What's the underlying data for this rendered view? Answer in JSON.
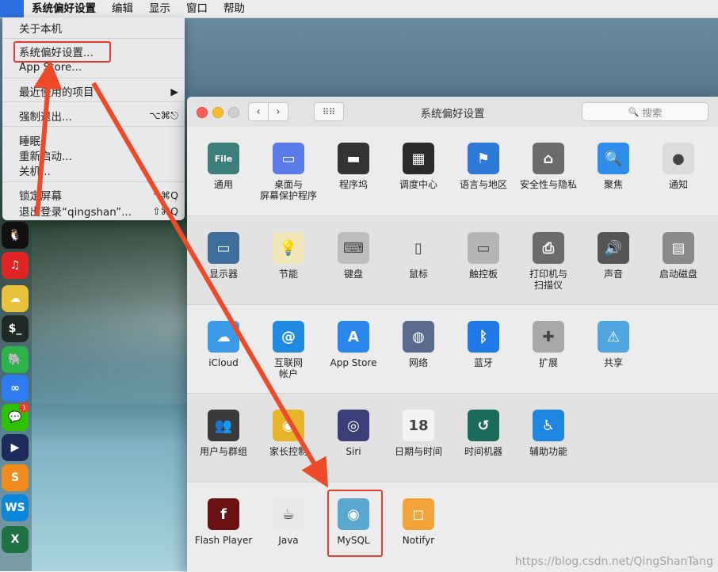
{
  "menubar": {
    "apple_glyph": "",
    "items": [
      "系统偏好设置",
      "编辑",
      "显示",
      "窗口",
      "帮助"
    ]
  },
  "apple_menu": {
    "items": [
      {
        "label": "关于本机",
        "shortcut": ""
      },
      {
        "label": "系统偏好设置...",
        "shortcut": ""
      },
      {
        "label": "App Store...",
        "shortcut": ""
      },
      {
        "label": "最近使用的项目",
        "shortcut": "▶"
      },
      {
        "label": "强制退出...",
        "shortcut": "⌥⌘⎋"
      },
      {
        "label": "睡眠",
        "shortcut": ""
      },
      {
        "label": "重新启动...",
        "shortcut": ""
      },
      {
        "label": "关机...",
        "shortcut": ""
      },
      {
        "label": "锁定屏幕",
        "shortcut": "^⌘Q"
      },
      {
        "label": "退出登录“qingshan”...",
        "shortcut": "⇧⌘Q"
      }
    ]
  },
  "dock": {
    "items": [
      {
        "icon": "qq-icon",
        "glyph": "🐧",
        "color": "#111111"
      },
      {
        "icon": "netease-music-icon",
        "glyph": "♫",
        "color": "#e02424"
      },
      {
        "icon": "cloud-drive-icon",
        "glyph": "☁",
        "color": "#e8c23a"
      },
      {
        "icon": "terminal-icon",
        "glyph": "$_",
        "color": "#1f2a26"
      },
      {
        "icon": "evernote-icon",
        "glyph": "🐘",
        "color": "#2db34a"
      },
      {
        "icon": "baidu-netdisk-icon",
        "glyph": "∞",
        "color": "#2e7bf2"
      },
      {
        "icon": "wechat-icon",
        "glyph": "💬",
        "color": "#2dc100",
        "badge": "1"
      },
      {
        "icon": "media-player-icon",
        "glyph": "▶",
        "color": "#1b2c5a"
      },
      {
        "icon": "sublime-text-icon",
        "glyph": "S",
        "color": "#f08b1e"
      },
      {
        "icon": "webstorm-icon",
        "glyph": "WS",
        "color": "#0c86d8"
      },
      {
        "icon": "excel-icon",
        "glyph": "X",
        "color": "#1f7244"
      }
    ]
  },
  "window": {
    "title": "系统偏好设置",
    "search_placeholder": "搜索",
    "search_glyph": "🔍",
    "back": "‹",
    "forward": "›",
    "grid_glyph": "⠿⠿",
    "sections": [
      [
        {
          "label": "通用",
          "icon": "general-icon",
          "glyph": "File",
          "color": "#3c7f7a"
        },
        {
          "label": "桌面与\n屏幕保护程序",
          "icon": "desktop-icon",
          "glyph": "▭",
          "color": "#5b7bea"
        },
        {
          "label": "程序坞",
          "icon": "dock-icon",
          "glyph": "▬",
          "color": "#333333"
        },
        {
          "label": "调度中心",
          "icon": "mission-control-icon",
          "glyph": "▦",
          "color": "#2a2a2a"
        },
        {
          "label": "语言与地区",
          "icon": "language-region-icon",
          "glyph": "⚑",
          "color": "#2e78d8"
        },
        {
          "label": "安全性与隐私",
          "icon": "security-icon",
          "glyph": "⌂",
          "color": "#6b6b6b"
        },
        {
          "label": "聚焦",
          "icon": "spotlight-icon",
          "glyph": "🔍",
          "color": "#2e8de8"
        },
        {
          "label": "通知",
          "icon": "notifications-icon",
          "glyph": "●",
          "color": "#dcdcdc"
        }
      ],
      [
        {
          "label": "显示器",
          "icon": "displays-icon",
          "glyph": "▭",
          "color": "#3d6e9c"
        },
        {
          "label": "节能",
          "icon": "energy-saver-icon",
          "glyph": "💡",
          "color": "#f0e6b8"
        },
        {
          "label": "键盘",
          "icon": "keyboard-icon",
          "glyph": "⌨",
          "color": "#bdbdbd"
        },
        {
          "label": "鼠标",
          "icon": "mouse-icon",
          "glyph": "▯",
          "color": "#e2e2e2"
        },
        {
          "label": "触控板",
          "icon": "trackpad-icon",
          "glyph": "▭",
          "color": "#b5b5b5"
        },
        {
          "label": "打印机与\n扫描仪",
          "icon": "printer-icon",
          "glyph": "⎙",
          "color": "#6b6b6b"
        },
        {
          "label": "声音",
          "icon": "sound-icon",
          "glyph": "🔊",
          "color": "#555555"
        },
        {
          "label": "启动磁盘",
          "icon": "startup-disk-icon",
          "glyph": "▤",
          "color": "#8a8a8a"
        }
      ],
      [
        {
          "label": "iCloud",
          "icon": "icloud-icon",
          "glyph": "☁",
          "color": "#3b9be8"
        },
        {
          "label": "互联网\n帐户",
          "icon": "internet-accounts-icon",
          "glyph": "@",
          "color": "#1e8ae0"
        },
        {
          "label": "App Store",
          "icon": "app-store-icon",
          "glyph": "A",
          "color": "#2a86ea"
        },
        {
          "label": "网络",
          "icon": "network-icon",
          "glyph": "◍",
          "color": "#5a6c8e"
        },
        {
          "label": "蓝牙",
          "icon": "bluetooth-icon",
          "glyph": "ᛒ",
          "color": "#1f7ae8"
        },
        {
          "label": "扩展",
          "icon": "extensions-icon",
          "glyph": "✚",
          "color": "#a8a8a8"
        },
        {
          "label": "共享",
          "icon": "sharing-icon",
          "glyph": "⚠",
          "color": "#4fa6e0"
        }
      ],
      [
        {
          "label": "用户与群组",
          "icon": "users-groups-icon",
          "glyph": "👥",
          "color": "#3a3a3a"
        },
        {
          "label": "家长控制",
          "icon": "parental-controls-icon",
          "glyph": "◉",
          "color": "#e7b52a"
        },
        {
          "label": "Siri",
          "icon": "siri-icon",
          "glyph": "◎",
          "color": "#3a3f78"
        },
        {
          "label": "日期与时间",
          "icon": "date-time-icon",
          "glyph": "18",
          "color": "#f2f2f2"
        },
        {
          "label": "时间机器",
          "icon": "time-machine-icon",
          "glyph": "↺",
          "color": "#1a6b5b"
        },
        {
          "label": "辅助功能",
          "icon": "accessibility-icon",
          "glyph": "♿",
          "color": "#1f86e0"
        }
      ],
      [
        {
          "label": "Flash Player",
          "icon": "flash-player-icon",
          "glyph": "f",
          "color": "#6b1111"
        },
        {
          "label": "Java",
          "icon": "java-icon",
          "glyph": "☕",
          "color": "#e8e8e8"
        },
        {
          "label": "MySQL",
          "icon": "mysql-icon",
          "glyph": "◉",
          "color": "#5aa7cf"
        },
        {
          "label": "Notifyr",
          "icon": "notifyr-icon",
          "glyph": "◻",
          "color": "#f2a33a"
        }
      ]
    ]
  },
  "watermark": "https://blog.csdn.net/QingShanTang",
  "colors": {
    "highlight": "#ea3a2a",
    "arrow": "#ec4a28"
  }
}
